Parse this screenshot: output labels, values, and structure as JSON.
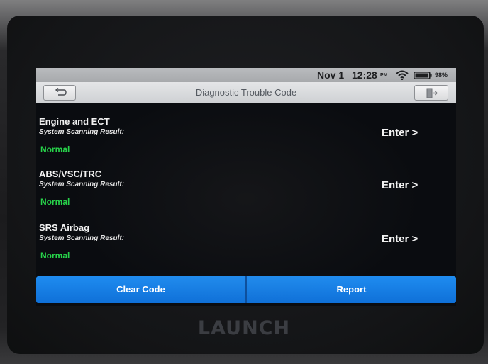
{
  "device": {
    "brand": "LAUNCH"
  },
  "status_bar": {
    "date": "Nov 1",
    "time": "12:28",
    "ampm": "PM",
    "wifi_icon": "wifi-icon",
    "battery_icon": "battery-icon",
    "battery_percent": "98%"
  },
  "title_bar": {
    "title": "Diagnostic Trouble Code",
    "back_icon": "back-arrow-icon",
    "exit_icon": "exit-icon"
  },
  "systems": [
    {
      "name": "Engine and ECT",
      "result_label": "System Scanning Result:",
      "status": "Normal",
      "enter_label": "Enter >"
    },
    {
      "name": "ABS/VSC/TRC",
      "result_label": "System Scanning Result:",
      "status": "Normal",
      "enter_label": "Enter >"
    },
    {
      "name": "SRS Airbag",
      "result_label": "System Scanning Result:",
      "status": "Normal",
      "enter_label": "Enter >"
    }
  ],
  "actions": {
    "clear_code": "Clear Code",
    "report": "Report"
  },
  "colors": {
    "status_normal": "#27d34a",
    "action_blue": "#1480e6",
    "screen_bg": "#0a0c10"
  }
}
